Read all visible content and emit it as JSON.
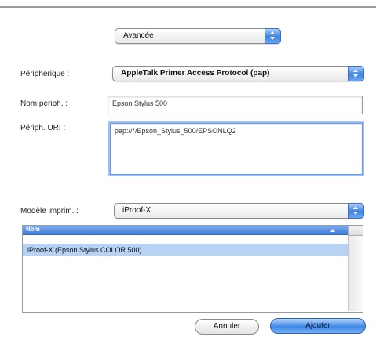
{
  "mode_popup": {
    "value": "Avancée"
  },
  "device": {
    "label": "Périphérique :",
    "value": "AppleTalk Primer Access Protocol (pap)"
  },
  "device_name": {
    "label": "Nom périph. :",
    "value": "Epson Stylus 500"
  },
  "device_uri": {
    "label": "Périph. URI :",
    "value": "pap://*/Epson_Stylus_500/EPSONLQ2"
  },
  "model": {
    "label": "Modèle imprim. :",
    "value": "iProof-X"
  },
  "model_list": {
    "column_header": "Nom",
    "rows": [
      "iProof-X (Epson Stylus COLOR 500)"
    ]
  },
  "buttons": {
    "cancel": "Annuler",
    "add": "Ajouter"
  },
  "colors": {
    "accent": "#3d83e0",
    "selection": "#b6d3f6"
  }
}
